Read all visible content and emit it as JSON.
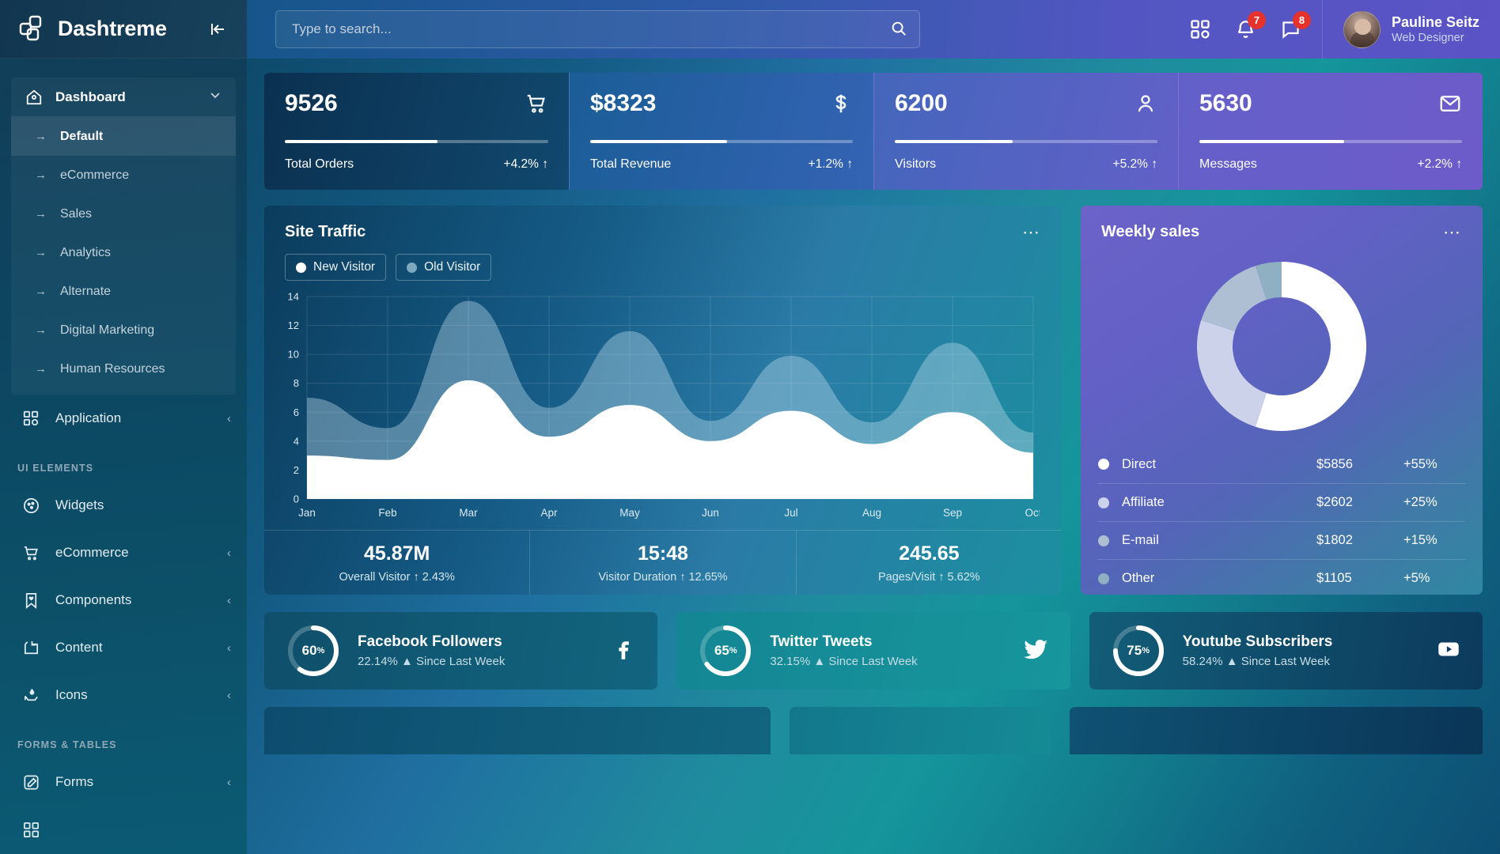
{
  "brand": {
    "name": "Dashtreme",
    "logo_icon": "dashtreme-logo-icon",
    "collapse_icon": "collapse-sidebar-icon"
  },
  "sidebar": {
    "dashboard": {
      "label": "Dashboard",
      "icon": "home-icon",
      "chevron": "chevron-down-icon"
    },
    "dashboard_children": [
      {
        "label": "Default",
        "active": true
      },
      {
        "label": "eCommerce",
        "active": false
      },
      {
        "label": "Sales",
        "active": false
      },
      {
        "label": "Analytics",
        "active": false
      },
      {
        "label": "Alternate",
        "active": false
      },
      {
        "label": "Digital Marketing",
        "active": false
      },
      {
        "label": "Human Resources",
        "active": false
      }
    ],
    "application": {
      "label": "Application",
      "icon": "grid-apps-icon",
      "chevron": "chevron-right-icon"
    },
    "section_ui": "UI ELEMENTS",
    "ui_items": [
      {
        "label": "Widgets",
        "icon": "cookie-widgets-icon",
        "chevron": ""
      },
      {
        "label": "eCommerce",
        "icon": "cart-icon",
        "chevron": "‹"
      },
      {
        "label": "Components",
        "icon": "bookmark-heart-icon",
        "chevron": "‹"
      },
      {
        "label": "Content",
        "icon": "content-folder-icon",
        "chevron": "‹"
      },
      {
        "label": "Icons",
        "icon": "hand-drop-icon",
        "chevron": "‹"
      }
    ],
    "section_forms": "FORMS & TABLES",
    "forms_items": [
      {
        "label": "Forms",
        "icon": "edit-square-icon",
        "chevron": "‹"
      }
    ]
  },
  "topbar": {
    "search": {
      "placeholder": "Type to search...",
      "value": "",
      "icon": "search-icon"
    },
    "apps_icon": "grid-apps-icon",
    "bell_icon": "bell-icon",
    "bell_badge": "7",
    "chat_icon": "chat-icon",
    "chat_badge": "8",
    "user": {
      "name": "Pauline Seitz",
      "role": "Web Designer",
      "avatar": "user-avatar"
    }
  },
  "kpis": [
    {
      "value": "9526",
      "label": "Total Orders",
      "delta": "+4.2%",
      "trend": "↑",
      "icon": "cart-icon",
      "progress": 58
    },
    {
      "value": "$8323",
      "label": "Total Revenue",
      "delta": "+1.2%",
      "trend": "↑",
      "icon": "dollar-icon",
      "progress": 52
    },
    {
      "value": "6200",
      "label": "Visitors",
      "delta": "+5.2%",
      "trend": "↑",
      "icon": "user-icon",
      "progress": 45
    },
    {
      "value": "5630",
      "label": "Messages",
      "delta": "+2.2%",
      "trend": "↑",
      "icon": "envelope-icon",
      "progress": 55
    }
  ],
  "site_traffic": {
    "title": "Site Traffic",
    "menu_icon": "more-options-icon",
    "legend": [
      {
        "label": "New Visitor",
        "color": "#ffffff"
      },
      {
        "label": "Old Visitor",
        "color": "#7ea8c0"
      }
    ],
    "stats": [
      {
        "value": "45.87M",
        "label": "Overall Visitor ↑ 2.43%"
      },
      {
        "value": "15:48",
        "label": "Visitor Duration ↑ 12.65%"
      },
      {
        "value": "245.65",
        "label": "Pages/Visit ↑ 5.62%"
      }
    ]
  },
  "weekly_sales": {
    "title": "Weekly sales",
    "menu_icon": "more-options-icon",
    "rows": [
      {
        "name": "Direct",
        "amount": "$5856",
        "percent": "+55%",
        "color": "#ffffff"
      },
      {
        "name": "Affiliate",
        "amount": "$2602",
        "percent": "+25%",
        "color": "#ccd2ea"
      },
      {
        "name": "E-mail",
        "amount": "$1802",
        "percent": "+15%",
        "color": "#aebfd4"
      },
      {
        "name": "Other",
        "amount": "$1105",
        "percent": "+5%",
        "color": "#8fb0c2"
      }
    ]
  },
  "social": [
    {
      "percent": "60",
      "title": "Facebook Followers",
      "sub": "22.14% ▲ Since Last Week",
      "icon": "facebook-icon"
    },
    {
      "percent": "65",
      "title": "Twitter Tweets",
      "sub": "32.15% ▲ Since Last Week",
      "icon": "twitter-icon"
    },
    {
      "percent": "75",
      "title": "Youtube Subscribers",
      "sub": "58.24% ▲ Since Last Week",
      "icon": "youtube-icon"
    }
  ],
  "chart_data": [
    {
      "type": "area",
      "title": "Site Traffic",
      "xlabel": "",
      "ylabel": "",
      "grid": true,
      "legend_position": "top-left",
      "categories": [
        "Jan",
        "Feb",
        "Mar",
        "Apr",
        "May",
        "Jun",
        "Jul",
        "Aug",
        "Sep",
        "Oct"
      ],
      "x_tick_labels": [
        "Jan",
        "Feb",
        "Mar",
        "Apr",
        "May",
        "Jun",
        "Jul",
        "Aug",
        "Sep",
        "Oct"
      ],
      "y_tick_labels": [
        "0",
        "2",
        "4",
        "6",
        "8",
        "10",
        "12",
        "14"
      ],
      "ylim": [
        0,
        14
      ],
      "series": [
        {
          "name": "New Visitor",
          "color": "#ffffff",
          "values": [
            3.0,
            2.7,
            8.2,
            4.3,
            6.5,
            4.0,
            6.1,
            3.8,
            6.0,
            3.2
          ]
        },
        {
          "name": "Old Visitor",
          "color": "#7ea8c0",
          "values": [
            7.0,
            4.9,
            13.7,
            6.3,
            11.6,
            5.4,
            9.9,
            5.3,
            10.8,
            4.6
          ]
        }
      ]
    },
    {
      "type": "pie",
      "title": "Weekly sales",
      "labels": [
        "Direct",
        "Affiliate",
        "E-mail",
        "Other"
      ],
      "values": [
        55,
        25,
        15,
        5
      ],
      "amounts": [
        "$5856",
        "$2602",
        "$1802",
        "$1105"
      ],
      "colors": [
        "#ffffff",
        "#ccd2ea",
        "#aebfd4",
        "#8fb0c2"
      ],
      "donut": true,
      "legend_position": "bottom"
    },
    {
      "type": "pie",
      "title": "Facebook Followers",
      "values": [
        60,
        40
      ],
      "labels": [
        "complete",
        "remaining"
      ],
      "donut": true
    },
    {
      "type": "pie",
      "title": "Twitter Tweets",
      "values": [
        65,
        35
      ],
      "labels": [
        "complete",
        "remaining"
      ],
      "donut": true
    },
    {
      "type": "pie",
      "title": "Youtube Subscribers",
      "values": [
        75,
        25
      ],
      "labels": [
        "complete",
        "remaining"
      ],
      "donut": true
    }
  ]
}
